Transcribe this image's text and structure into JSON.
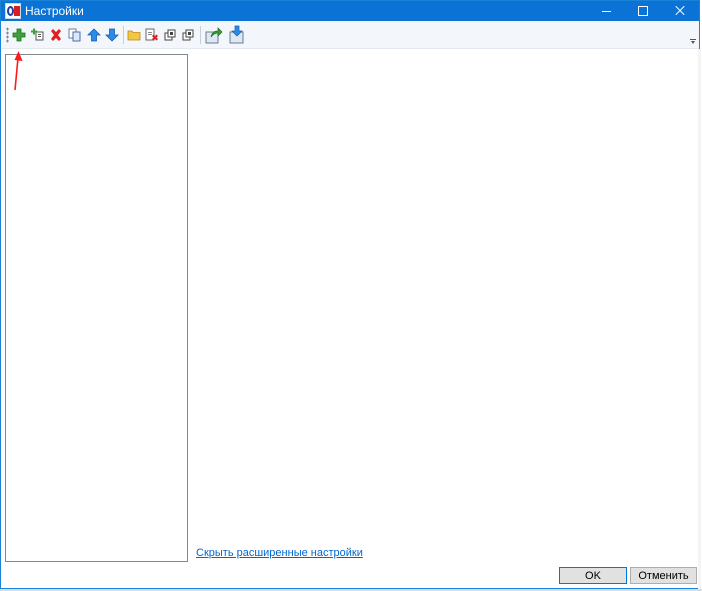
{
  "window": {
    "title": "Настройки",
    "title_bar_color": "#0b72d6",
    "controls": {
      "minimize_icon": "minimize-icon",
      "maximize_icon": "maximize-icon",
      "close_icon": "close-icon"
    }
  },
  "toolbar": {
    "items": [
      {
        "name": "add",
        "icon": "green-plus-icon"
      },
      {
        "name": "add-child",
        "icon": "add-child-icon"
      },
      {
        "name": "delete",
        "icon": "red-x-icon"
      },
      {
        "name": "copy",
        "icon": "copy-icon"
      },
      {
        "name": "move-up",
        "icon": "blue-up-arrow-icon"
      },
      {
        "name": "move-down",
        "icon": "blue-down-arrow-icon"
      },
      {
        "name": "folder",
        "icon": "folder-icon"
      },
      {
        "name": "delete-settings",
        "icon": "delete-document-icon"
      },
      {
        "name": "duplicate-a",
        "icon": "duplicate-icon"
      },
      {
        "name": "duplicate-b",
        "icon": "duplicate-icon"
      },
      {
        "name": "export",
        "icon": "export-icon"
      },
      {
        "name": "import",
        "icon": "import-icon"
      }
    ]
  },
  "links": {
    "hide_advanced": "Скрыть расширенные настройки"
  },
  "buttons": {
    "ok": "OK",
    "cancel": "Отменить"
  },
  "colors": {
    "accent": "#0078d7",
    "link": "#0066cc",
    "annotation_arrow": "#ff0000"
  }
}
